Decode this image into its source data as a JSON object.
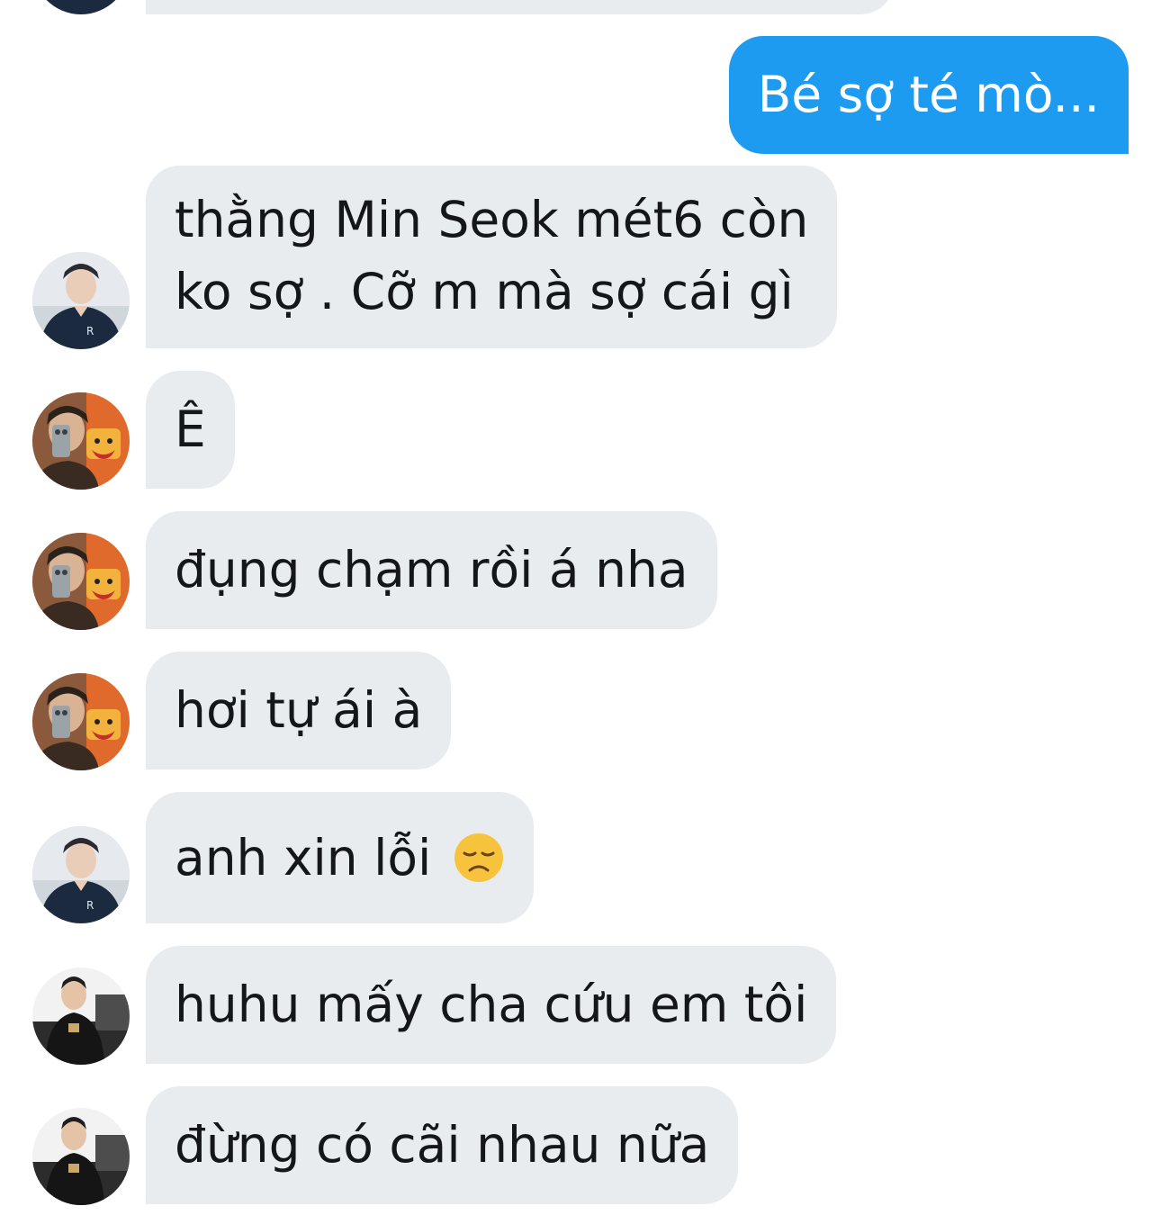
{
  "colors": {
    "sent_bubble": "#1d9bf0",
    "received_bubble": "#e9ecef",
    "received_text": "#141619",
    "sent_text": "#ffffff"
  },
  "messages": [
    {
      "sender": "other",
      "avatar": "player-avatar-jersey",
      "text": ""
    },
    {
      "sender": "me",
      "text": "Bé sợ té mò..."
    },
    {
      "sender": "other",
      "avatar": "player-avatar-jersey",
      "line1": "thằng Min Seok mét6 còn",
      "line2": "ko sợ . Cỡ m mà sợ cái gì"
    },
    {
      "sender": "other",
      "avatar": "mirror-selfie-avatar",
      "text": "Ê"
    },
    {
      "sender": "other",
      "avatar": "mirror-selfie-avatar",
      "text": "đụng chạm rồi á nha"
    },
    {
      "sender": "other",
      "avatar": "mirror-selfie-avatar",
      "text": "hơi tự ái à"
    },
    {
      "sender": "other",
      "avatar": "player-avatar-jersey",
      "text": "anh xin lỗi",
      "emoji": "disappointed-face-emoji"
    },
    {
      "sender": "other",
      "avatar": "seated-man-avatar",
      "text": "huhu mấy cha cứu em tôi"
    },
    {
      "sender": "other",
      "avatar": "seated-man-avatar",
      "text": "đừng có cãi nhau nữa"
    }
  ]
}
